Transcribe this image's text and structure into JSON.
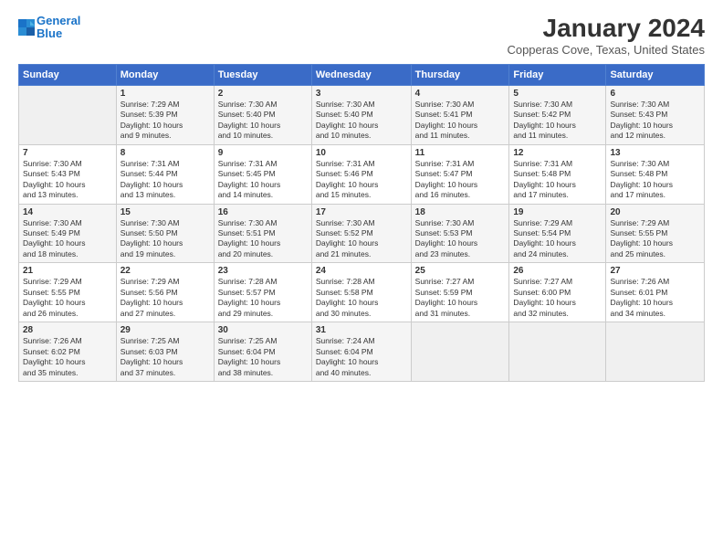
{
  "header": {
    "logo_line1": "General",
    "logo_line2": "Blue",
    "title": "January 2024",
    "subtitle": "Copperas Cove, Texas, United States"
  },
  "weekdays": [
    "Sunday",
    "Monday",
    "Tuesday",
    "Wednesday",
    "Thursday",
    "Friday",
    "Saturday"
  ],
  "weeks": [
    [
      {
        "day": "",
        "info": ""
      },
      {
        "day": "1",
        "info": "Sunrise: 7:29 AM\nSunset: 5:39 PM\nDaylight: 10 hours\nand 9 minutes."
      },
      {
        "day": "2",
        "info": "Sunrise: 7:30 AM\nSunset: 5:40 PM\nDaylight: 10 hours\nand 10 minutes."
      },
      {
        "day": "3",
        "info": "Sunrise: 7:30 AM\nSunset: 5:40 PM\nDaylight: 10 hours\nand 10 minutes."
      },
      {
        "day": "4",
        "info": "Sunrise: 7:30 AM\nSunset: 5:41 PM\nDaylight: 10 hours\nand 11 minutes."
      },
      {
        "day": "5",
        "info": "Sunrise: 7:30 AM\nSunset: 5:42 PM\nDaylight: 10 hours\nand 11 minutes."
      },
      {
        "day": "6",
        "info": "Sunrise: 7:30 AM\nSunset: 5:43 PM\nDaylight: 10 hours\nand 12 minutes."
      }
    ],
    [
      {
        "day": "7",
        "info": "Sunrise: 7:30 AM\nSunset: 5:43 PM\nDaylight: 10 hours\nand 13 minutes."
      },
      {
        "day": "8",
        "info": "Sunrise: 7:31 AM\nSunset: 5:44 PM\nDaylight: 10 hours\nand 13 minutes."
      },
      {
        "day": "9",
        "info": "Sunrise: 7:31 AM\nSunset: 5:45 PM\nDaylight: 10 hours\nand 14 minutes."
      },
      {
        "day": "10",
        "info": "Sunrise: 7:31 AM\nSunset: 5:46 PM\nDaylight: 10 hours\nand 15 minutes."
      },
      {
        "day": "11",
        "info": "Sunrise: 7:31 AM\nSunset: 5:47 PM\nDaylight: 10 hours\nand 16 minutes."
      },
      {
        "day": "12",
        "info": "Sunrise: 7:31 AM\nSunset: 5:48 PM\nDaylight: 10 hours\nand 17 minutes."
      },
      {
        "day": "13",
        "info": "Sunrise: 7:30 AM\nSunset: 5:48 PM\nDaylight: 10 hours\nand 17 minutes."
      }
    ],
    [
      {
        "day": "14",
        "info": "Sunrise: 7:30 AM\nSunset: 5:49 PM\nDaylight: 10 hours\nand 18 minutes."
      },
      {
        "day": "15",
        "info": "Sunrise: 7:30 AM\nSunset: 5:50 PM\nDaylight: 10 hours\nand 19 minutes."
      },
      {
        "day": "16",
        "info": "Sunrise: 7:30 AM\nSunset: 5:51 PM\nDaylight: 10 hours\nand 20 minutes."
      },
      {
        "day": "17",
        "info": "Sunrise: 7:30 AM\nSunset: 5:52 PM\nDaylight: 10 hours\nand 21 minutes."
      },
      {
        "day": "18",
        "info": "Sunrise: 7:30 AM\nSunset: 5:53 PM\nDaylight: 10 hours\nand 23 minutes."
      },
      {
        "day": "19",
        "info": "Sunrise: 7:29 AM\nSunset: 5:54 PM\nDaylight: 10 hours\nand 24 minutes."
      },
      {
        "day": "20",
        "info": "Sunrise: 7:29 AM\nSunset: 5:55 PM\nDaylight: 10 hours\nand 25 minutes."
      }
    ],
    [
      {
        "day": "21",
        "info": "Sunrise: 7:29 AM\nSunset: 5:55 PM\nDaylight: 10 hours\nand 26 minutes."
      },
      {
        "day": "22",
        "info": "Sunrise: 7:29 AM\nSunset: 5:56 PM\nDaylight: 10 hours\nand 27 minutes."
      },
      {
        "day": "23",
        "info": "Sunrise: 7:28 AM\nSunset: 5:57 PM\nDaylight: 10 hours\nand 29 minutes."
      },
      {
        "day": "24",
        "info": "Sunrise: 7:28 AM\nSunset: 5:58 PM\nDaylight: 10 hours\nand 30 minutes."
      },
      {
        "day": "25",
        "info": "Sunrise: 7:27 AM\nSunset: 5:59 PM\nDaylight: 10 hours\nand 31 minutes."
      },
      {
        "day": "26",
        "info": "Sunrise: 7:27 AM\nSunset: 6:00 PM\nDaylight: 10 hours\nand 32 minutes."
      },
      {
        "day": "27",
        "info": "Sunrise: 7:26 AM\nSunset: 6:01 PM\nDaylight: 10 hours\nand 34 minutes."
      }
    ],
    [
      {
        "day": "28",
        "info": "Sunrise: 7:26 AM\nSunset: 6:02 PM\nDaylight: 10 hours\nand 35 minutes."
      },
      {
        "day": "29",
        "info": "Sunrise: 7:25 AM\nSunset: 6:03 PM\nDaylight: 10 hours\nand 37 minutes."
      },
      {
        "day": "30",
        "info": "Sunrise: 7:25 AM\nSunset: 6:04 PM\nDaylight: 10 hours\nand 38 minutes."
      },
      {
        "day": "31",
        "info": "Sunrise: 7:24 AM\nSunset: 6:04 PM\nDaylight: 10 hours\nand 40 minutes."
      },
      {
        "day": "",
        "info": ""
      },
      {
        "day": "",
        "info": ""
      },
      {
        "day": "",
        "info": ""
      }
    ]
  ]
}
